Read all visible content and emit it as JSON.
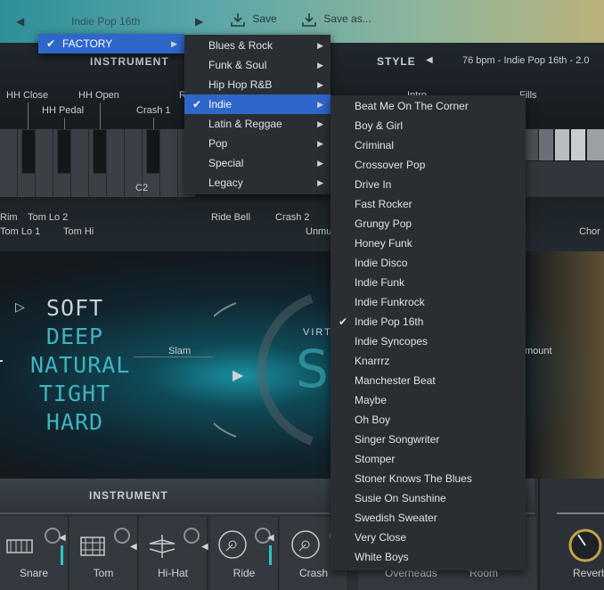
{
  "topbar": {
    "preset_name": "Indie Pop 16th",
    "save_label": "Save",
    "save_as_label": "Save as..."
  },
  "instrument_title": "INSTRUMENT",
  "style_section": {
    "title": "STYLE",
    "info": "76 bpm - Indie Pop 16th - 2.0",
    "intro_label": "Intro",
    "fills_label": "Fills",
    "chorus_label": "Chor"
  },
  "drum_labels": {
    "hh_close": "HH Close",
    "hh_open": "HH Open",
    "hh_pedal": "HH Pedal",
    "crash1": "Crash 1",
    "r_partial": "R",
    "c2": "C2",
    "rim": "Rim",
    "tom_lo2": "Tom Lo 2",
    "tom_lo1": "Tom Lo 1",
    "tom_hi": "Tom Hi",
    "ride_bell": "Ride Bell",
    "crash2": "Crash 2",
    "unmute_partial": "Unmu"
  },
  "visual": {
    "styles": [
      "SOFT",
      "DEEP",
      "NATURAL",
      "TIGHT",
      "HARD"
    ],
    "slam_label": "Slam",
    "amount_label": "mount",
    "virt_label": "VIRT"
  },
  "bottom": {
    "title": "INSTRUMENT",
    "slots": [
      "Snare",
      "Tom",
      "Hi-Hat",
      "Ride",
      "Crash",
      "Overheads",
      "Room",
      "Reverb"
    ]
  },
  "menu_root": {
    "items": [
      {
        "label": "FACTORY",
        "checked": true
      }
    ]
  },
  "menu_categories": {
    "items": [
      {
        "label": "Blues & Rock",
        "checked": false
      },
      {
        "label": "Funk & Soul",
        "checked": false
      },
      {
        "label": "Hip Hop R&B",
        "checked": false
      },
      {
        "label": "Indie",
        "checked": true
      },
      {
        "label": "Latin & Reggae",
        "checked": false
      },
      {
        "label": "Pop",
        "checked": false
      },
      {
        "label": "Special",
        "checked": false
      },
      {
        "label": "Legacy",
        "checked": false
      }
    ]
  },
  "menu_presets": {
    "items": [
      {
        "label": "Beat Me On The Corner",
        "checked": false
      },
      {
        "label": "Boy & Girl",
        "checked": false
      },
      {
        "label": "Criminal",
        "checked": false
      },
      {
        "label": "Crossover Pop",
        "checked": false
      },
      {
        "label": "Drive In",
        "checked": false
      },
      {
        "label": "Fast Rocker",
        "checked": false
      },
      {
        "label": "Grungy Pop",
        "checked": false
      },
      {
        "label": "Honey Funk",
        "checked": false
      },
      {
        "label": "Indie Disco",
        "checked": false
      },
      {
        "label": "Indie Funk",
        "checked": false
      },
      {
        "label": "Indie Funkrock",
        "checked": false
      },
      {
        "label": "Indie Pop 16th",
        "checked": true
      },
      {
        "label": "Indie Syncopes",
        "checked": false
      },
      {
        "label": "Knarrrz",
        "checked": false
      },
      {
        "label": "Manchester Beat",
        "checked": false
      },
      {
        "label": "Maybe",
        "checked": false
      },
      {
        "label": "Oh Boy",
        "checked": false
      },
      {
        "label": "Singer Songwriter",
        "checked": false
      },
      {
        "label": "Stomper",
        "checked": false
      },
      {
        "label": "Stoner Knows The Blues",
        "checked": false
      },
      {
        "label": "Susie On Sunshine",
        "checked": false
      },
      {
        "label": "Swedish Sweater",
        "checked": false
      },
      {
        "label": "Very Close",
        "checked": false
      },
      {
        "label": "White Boys",
        "checked": false
      }
    ]
  },
  "colors": {
    "selection": "#2e66c9",
    "accent_teal": "#2fc3c8"
  }
}
